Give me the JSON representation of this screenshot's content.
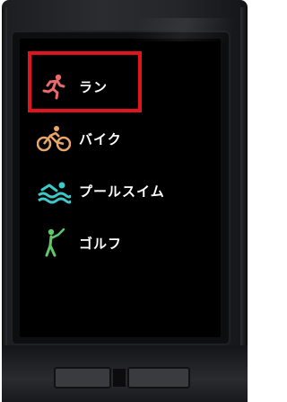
{
  "menu": {
    "items": [
      {
        "label": "ラン",
        "icon": "running-icon",
        "color": "#e86a6a",
        "selected": true
      },
      {
        "label": "バイク",
        "icon": "cycling-icon",
        "color": "#e8a66a",
        "selected": false
      },
      {
        "label": "プールスイム",
        "icon": "swimming-icon",
        "color": "#3ec9c9",
        "selected": false
      },
      {
        "label": "ゴルフ",
        "icon": "golf-icon",
        "color": "#5fc86a",
        "selected": false
      }
    ]
  },
  "highlight": {
    "color": "#e0141e",
    "target": "menu.items.0"
  }
}
